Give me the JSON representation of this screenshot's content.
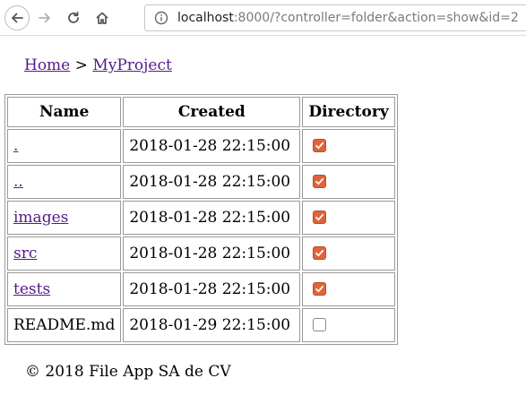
{
  "browser": {
    "url_host": "localhost",
    "url_rest": ":8000/?controller=folder&action=show&id=2",
    "icons": {
      "back": "back-arrow-icon",
      "forward": "forward-arrow-icon",
      "reload": "reload-icon",
      "home": "home-icon",
      "info": "info-icon"
    }
  },
  "breadcrumb": {
    "home_label": "Home",
    "separator": ">",
    "current_label": "MyProject"
  },
  "table": {
    "headers": [
      "Name",
      "Created",
      "Directory"
    ],
    "rows": [
      {
        "name": ".",
        "created": "2018-01-28 22:15:00",
        "directory": true,
        "is_link": true
      },
      {
        "name": "..",
        "created": "2018-01-28 22:15:00",
        "directory": true,
        "is_link": true
      },
      {
        "name": "images",
        "created": "2018-01-28 22:15:00",
        "directory": true,
        "is_link": true
      },
      {
        "name": "src",
        "created": "2018-01-28 22:15:00",
        "directory": true,
        "is_link": true
      },
      {
        "name": "tests",
        "created": "2018-01-28 22:15:00",
        "directory": true,
        "is_link": true
      },
      {
        "name": "README.md",
        "created": "2018-01-29 22:15:00",
        "directory": false,
        "is_link": false
      }
    ]
  },
  "footer": {
    "text": "© 2018 File App SA de CV"
  },
  "colors": {
    "link": "#551a8b",
    "checkbox_checked": "#e0643a"
  }
}
